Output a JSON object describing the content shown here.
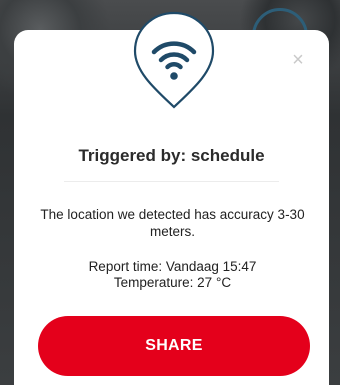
{
  "dialog": {
    "title": "Triggered by: schedule",
    "accuracy_text": "The location we detected has accuracy 3-30 meters.",
    "report_time": "Report time: Vandaag 15:47",
    "temperature": "Temperature: 27 °C",
    "close_glyph": "×",
    "share_label": "SHARE",
    "icon": "wifi-location-pin-icon"
  },
  "colors": {
    "accent": "#e4001b",
    "icon_stroke": "#1f4a68",
    "card_bg": "#ffffff"
  }
}
